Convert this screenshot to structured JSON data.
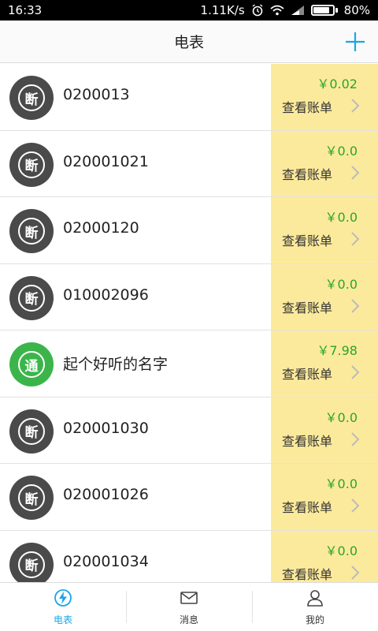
{
  "status": {
    "time": "16:33",
    "speed": "1.11K/s",
    "battery": "80%"
  },
  "header": {
    "title": "电表",
    "add_icon": "plus-icon"
  },
  "colors": {
    "accent": "#1aa6e6",
    "off_badge": "#4a4a4a",
    "on_badge": "#3bb54a",
    "bill_bg": "#fcea9c",
    "amount": "#2aa52a"
  },
  "meters": [
    {
      "badge": "断",
      "status": "off",
      "name": "0200013",
      "amount": "￥0.02",
      "bill_label": "查看账单"
    },
    {
      "badge": "断",
      "status": "off",
      "name": "020001021",
      "amount": "￥0.0",
      "bill_label": "查看账单"
    },
    {
      "badge": "断",
      "status": "off",
      "name": "02000120",
      "amount": "￥0.0",
      "bill_label": "查看账单"
    },
    {
      "badge": "断",
      "status": "off",
      "name": "010002096",
      "amount": "￥0.0",
      "bill_label": "查看账单"
    },
    {
      "badge": "通",
      "status": "on",
      "name": "起个好听的名字",
      "amount": "￥7.98",
      "bill_label": "查看账单"
    },
    {
      "badge": "断",
      "status": "off",
      "name": "020001030",
      "amount": "￥0.0",
      "bill_label": "查看账单"
    },
    {
      "badge": "断",
      "status": "off",
      "name": "020001026",
      "amount": "￥0.0",
      "bill_label": "查看账单"
    },
    {
      "badge": "断",
      "status": "off",
      "name": "020001034",
      "amount": "￥0.0",
      "bill_label": "查看账单"
    }
  ],
  "tabs": [
    {
      "label": "电表",
      "icon": "lightning-icon",
      "active": true
    },
    {
      "label": "消息",
      "icon": "envelope-icon",
      "active": false
    },
    {
      "label": "我的",
      "icon": "person-icon",
      "active": false
    }
  ]
}
